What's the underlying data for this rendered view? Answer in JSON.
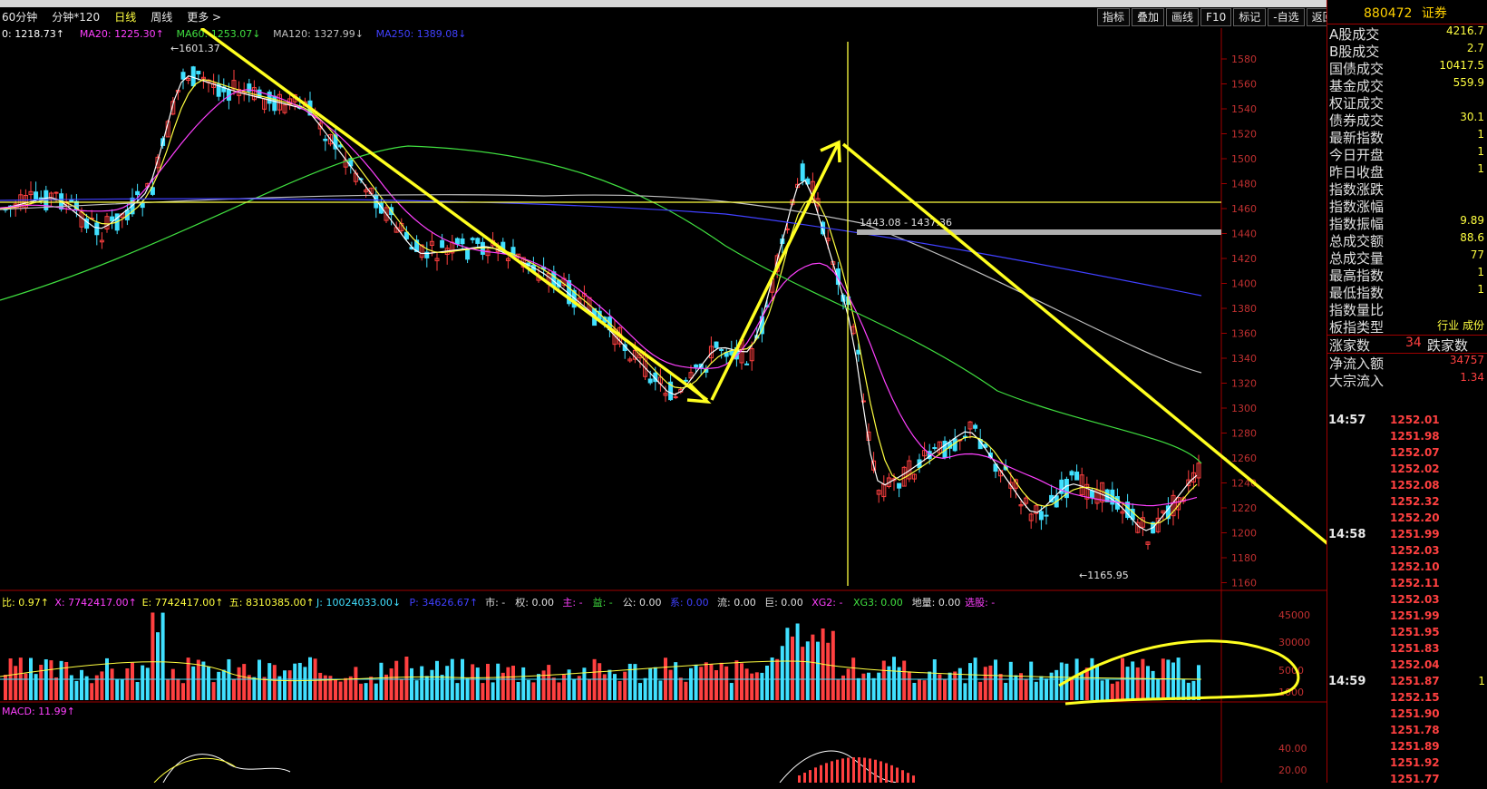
{
  "window": {
    "title_fragment": "…"
  },
  "tabs": [
    "60分钟",
    "分钟*120",
    "日线",
    "周线",
    "更多 >"
  ],
  "active_tab": "日线",
  "tools": [
    "指标",
    "叠加",
    "画线",
    "F10",
    "标记",
    "-自选",
    "返回"
  ],
  "ma_legend": [
    {
      "label": "0: 1218.73↑",
      "color": "#ffffff"
    },
    {
      "label": "MA20: 1225.30↑",
      "color": "#ff40ff"
    },
    {
      "label": "MA60: 1253.07↓",
      "color": "#40e040"
    },
    {
      "label": "MA120: 1327.99↓",
      "color": "#c0c0c0"
    },
    {
      "label": "MA250: 1389.08↓",
      "color": "#4040ff"
    }
  ],
  "price_axis": [
    "1580",
    "1560",
    "1540",
    "1520",
    "1500",
    "1480",
    "1460",
    "1440",
    "1420",
    "1400",
    "1380",
    "1360",
    "1340",
    "1320",
    "1300",
    "1280",
    "1260",
    "1240",
    "1220",
    "1200",
    "1180",
    "1160"
  ],
  "price_annotations": {
    "high": "1601.37",
    "low": "1165.95",
    "crosshair": "1443.08 - 1437.36"
  },
  "vol_legend": [
    {
      "label": "比: 0.97↑",
      "color": "#ffff40"
    },
    {
      "label": "X: 7742417.00↑",
      "color": "#ff40ff"
    },
    {
      "label": "E: 7742417.00↑",
      "color": "#ffff40"
    },
    {
      "label": "五: 8310385.00↑",
      "color": "#ffff40"
    },
    {
      "label": "J: 10024033.00↓",
      "color": "#40e0ff"
    },
    {
      "label": "P: 34626.67↑",
      "color": "#4040ff"
    },
    {
      "label": "市: -",
      "color": "#e0e0e0"
    },
    {
      "label": "权: 0.00",
      "color": "#e0e0e0"
    },
    {
      "label": "主: -",
      "color": "#ff40ff"
    },
    {
      "label": "益: -",
      "color": "#40e040"
    },
    {
      "label": "公: 0.00",
      "color": "#e0e0e0"
    },
    {
      "label": "系: 0.00",
      "color": "#4040ff"
    },
    {
      "label": "流: 0.00",
      "color": "#e0e0e0"
    },
    {
      "label": "巨: 0.00",
      "color": "#e0e0e0"
    },
    {
      "label": "XG2: -",
      "color": "#ff40ff"
    },
    {
      "label": "XG3: 0.00",
      "color": "#40e040"
    },
    {
      "label": "地量: 0.00",
      "color": "#e0e0e0"
    },
    {
      "label": "选股: -",
      "color": "#ff40ff"
    }
  ],
  "vol_axis": [
    "45000",
    "30000",
    "5000",
    "1000"
  ],
  "macd_legend": "MACD: 11.99↑",
  "macd_axis": [
    "40.00",
    "20.00"
  ],
  "panel": {
    "code": "880472",
    "name": "证券",
    "rows": [
      {
        "k": "A股成交",
        "v": "4216.7"
      },
      {
        "k": "B股成交",
        "v": "2.7"
      },
      {
        "k": "国债成交",
        "v": "10417.5"
      },
      {
        "k": "基金成交",
        "v": "559.9"
      },
      {
        "k": "权证成交",
        "v": ""
      },
      {
        "k": "债券成交",
        "v": "30.1"
      },
      {
        "k": "最新指数",
        "v": "1"
      },
      {
        "k": "今日开盘",
        "v": "1"
      },
      {
        "k": "昨日收盘",
        "v": "1"
      },
      {
        "k": "指数涨跌",
        "v": ""
      },
      {
        "k": "指数涨幅",
        "v": ""
      },
      {
        "k": "指数振幅",
        "v": "9.89"
      },
      {
        "k": "总成交额",
        "v": "88.6"
      },
      {
        "k": "总成交量",
        "v": "77"
      },
      {
        "k": "最高指数",
        "v": "1"
      },
      {
        "k": "最低指数",
        "v": "1"
      },
      {
        "k": "指数量比",
        "v": ""
      },
      {
        "k": "板指类型",
        "v": "行业 成份"
      }
    ],
    "updown": {
      "up_label": "涨家数",
      "up": "34",
      "down_label": "跌家数"
    },
    "flows": [
      {
        "k": "净流入额",
        "v": "34757"
      },
      {
        "k": "大宗流入",
        "v": "1.34"
      }
    ],
    "ticks": [
      {
        "t": "14:57",
        "p": "1252.01"
      },
      {
        "t": "",
        "p": "1251.98"
      },
      {
        "t": "",
        "p": "1252.07"
      },
      {
        "t": "",
        "p": "1252.02"
      },
      {
        "t": "",
        "p": "1252.08"
      },
      {
        "t": "",
        "p": "1252.32"
      },
      {
        "t": "",
        "p": "1252.20"
      },
      {
        "t": "14:58",
        "p": "1251.99"
      },
      {
        "t": "",
        "p": "1252.03"
      },
      {
        "t": "",
        "p": "1252.10"
      },
      {
        "t": "",
        "p": "1252.11"
      },
      {
        "t": "",
        "p": "1252.03"
      },
      {
        "t": "",
        "p": "1251.99"
      },
      {
        "t": "",
        "p": "1251.95"
      },
      {
        "t": "",
        "p": "1251.83"
      },
      {
        "t": "",
        "p": "1252.04"
      },
      {
        "t": "14:59",
        "p": "1251.87",
        "vol": "1"
      },
      {
        "t": "",
        "p": "1252.15"
      },
      {
        "t": "",
        "p": "1251.90"
      },
      {
        "t": "",
        "p": "1251.78"
      },
      {
        "t": "",
        "p": "1251.89"
      },
      {
        "t": "",
        "p": "1251.92"
      },
      {
        "t": "",
        "p": "1251.77"
      }
    ]
  }
}
